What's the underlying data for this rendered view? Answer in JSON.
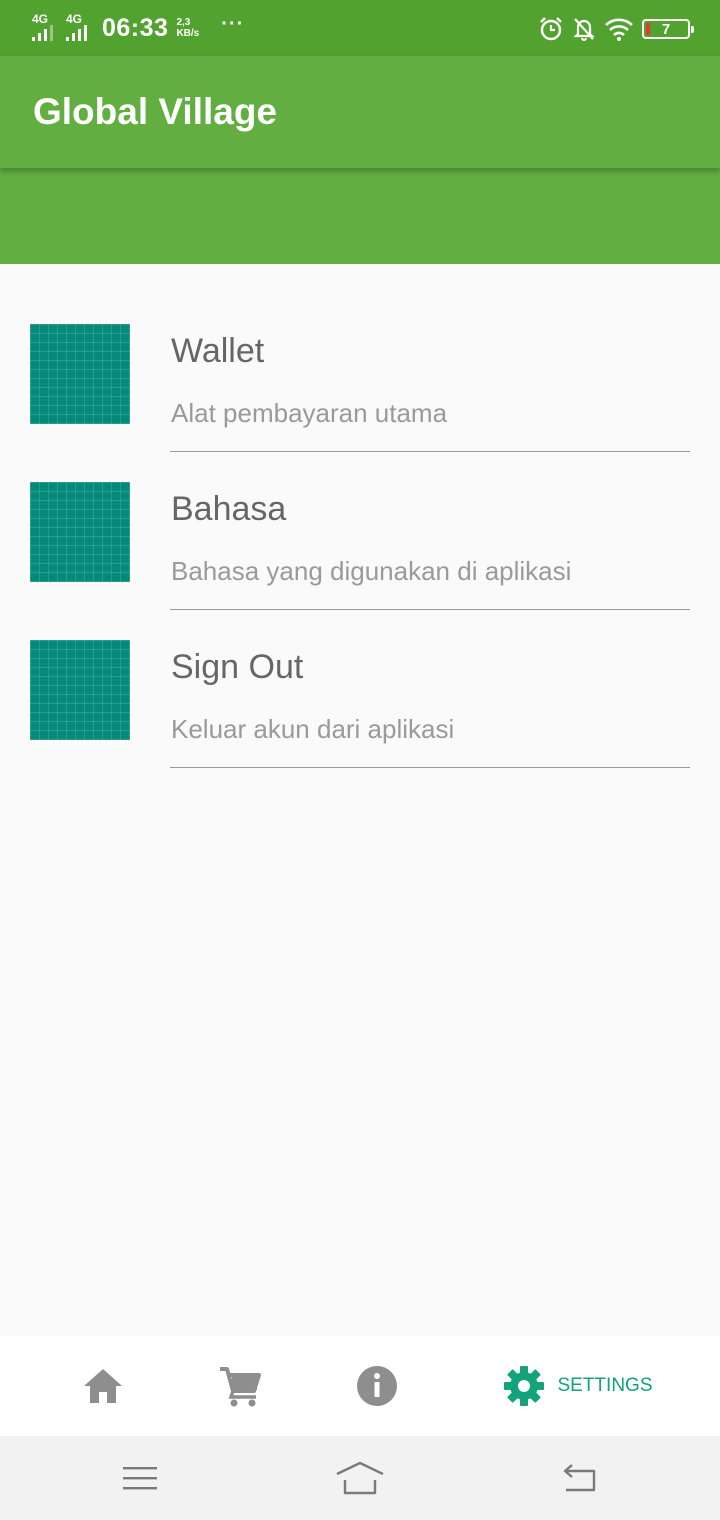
{
  "status_bar": {
    "network_1": "4G",
    "network_2": "4G",
    "time": "06:33",
    "speed_value": "2,3",
    "speed_unit": "KB/s",
    "more": "···",
    "battery_level": "7"
  },
  "app_bar": {
    "title": "Global Village"
  },
  "settings_list": [
    {
      "title": "Wallet",
      "subtitle": "Alat pembayaran utama"
    },
    {
      "title": "Bahasa",
      "subtitle": "Bahasa yang digunakan di aplikasi"
    },
    {
      "title": "Sign Out",
      "subtitle": "Keluar akun dari aplikasi"
    }
  ],
  "bottom_nav": {
    "items": [
      {
        "icon": "home-icon",
        "label": ""
      },
      {
        "icon": "cart-icon",
        "label": ""
      },
      {
        "icon": "info-icon",
        "label": ""
      },
      {
        "icon": "gear-icon",
        "label": "SETTINGS",
        "active": true
      }
    ]
  },
  "system_nav": {
    "items": [
      "menu-icon",
      "home-outline-icon",
      "back-icon"
    ]
  },
  "colors": {
    "status_bar": "#52a22f",
    "primary": "#62ae41",
    "thumbnail": "#04897b",
    "active_nav": "#13a37a",
    "inactive_nav": "#8e8e8e"
  }
}
